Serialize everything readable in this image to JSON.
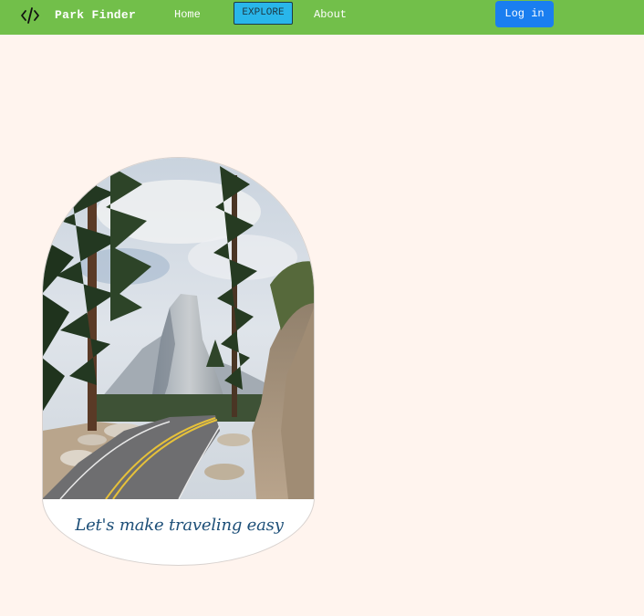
{
  "nav": {
    "brand": "Park Finder",
    "brand_icon": "code-icon",
    "links": {
      "home": "Home",
      "explore": "EXPLORE",
      "about": "About"
    },
    "login": "Log in"
  },
  "hero": {
    "image": "mountain-road-landscape",
    "tagline": "Let's make traveling easy"
  },
  "colors": {
    "navbar": "#72bf4a",
    "page_background": "#fff4ee",
    "explore_button": "#29b6ea",
    "login_button": "#1a7ef0",
    "tagline": "#1d4f78"
  }
}
